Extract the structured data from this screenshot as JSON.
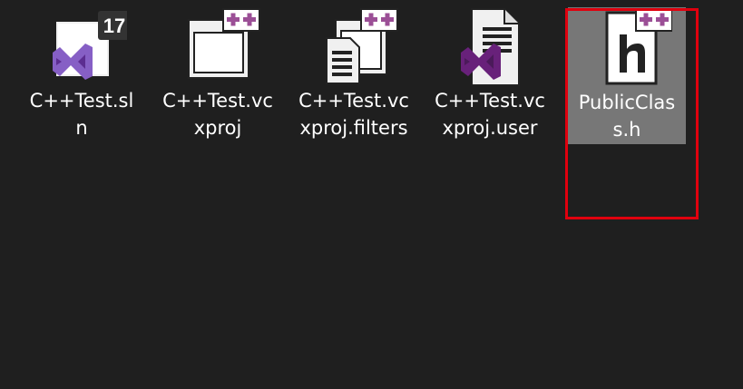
{
  "colors": {
    "background": "#1f1f1f",
    "selection": "#777777",
    "highlight_border": "#e0000e",
    "vs_purple": "#865fc5",
    "plus_purple": "#9b4f96",
    "icon_white": "#f0f0f0"
  },
  "files": [
    {
      "name": "C++Test.sln",
      "icon": "visual-studio-solution-icon",
      "badge": "17",
      "selected": false
    },
    {
      "name": "C++Test.vcxproj",
      "icon": "cpp-project-icon",
      "selected": false
    },
    {
      "name": "C++Test.vcxproj.filters",
      "icon": "cpp-filters-icon",
      "selected": false
    },
    {
      "name": "C++Test.vcxproj.user",
      "icon": "cpp-user-icon",
      "selected": false
    },
    {
      "name": "PublicClass.h",
      "icon": "cpp-header-icon",
      "selected": true
    }
  ]
}
